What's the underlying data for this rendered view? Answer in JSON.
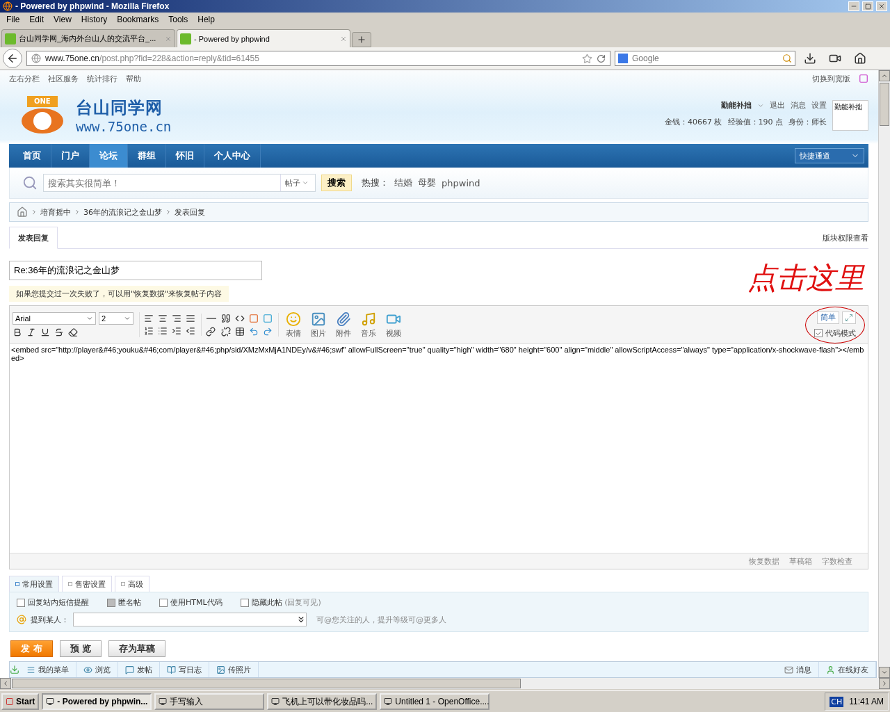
{
  "window": {
    "title": "- Powered by phpwind - Mozilla Firefox"
  },
  "menu": [
    "File",
    "Edit",
    "View",
    "History",
    "Bookmarks",
    "Tools",
    "Help"
  ],
  "browser_tabs": [
    {
      "label": "台山同学网_海内外台山人的交流平台_...",
      "selected": false
    },
    {
      "label": "- Powered by phpwind",
      "selected": true
    }
  ],
  "address": {
    "host": "www.75one.cn",
    "path": "/post.php?fid=228&action=reply&tid=61455"
  },
  "web_search": {
    "placeholder": "Google"
  },
  "page": {
    "top_links": [
      "左右分栏",
      "社区服务",
      "统计排行",
      "帮助"
    ],
    "switch_link": "切换到宽版",
    "logo": {
      "badge": "ONE",
      "name": "台山同学网",
      "url": "www.75one.cn"
    },
    "user": {
      "name": "勤能补拙",
      "links": [
        "退出",
        "消息",
        "设置"
      ],
      "stats": [
        "金钱：40667 枚",
        "经验值：190 点",
        "身份：师长"
      ],
      "avatar_label": "勤能补拙"
    },
    "nav": [
      {
        "label": "首页",
        "selected": false
      },
      {
        "label": "门户",
        "selected": false
      },
      {
        "label": "论坛",
        "selected": true
      },
      {
        "label": "群组",
        "selected": false
      },
      {
        "label": "怀旧",
        "selected": false
      },
      {
        "label": "个人中心",
        "selected": false
      }
    ],
    "quick_access": "快捷通道",
    "search": {
      "placeholder": "搜索其实很简单！",
      "scope": "帖子",
      "button": "搜索",
      "hot_label": "热搜：",
      "hot": [
        "结婚",
        "母婴",
        "phpwind"
      ]
    },
    "breadcrumb": [
      "培育摇中",
      "36年的流浪记之金山梦",
      "发表回复"
    ],
    "post_tab": {
      "label": "发表回复",
      "selected": true
    },
    "permissions_link": "版块权限查看",
    "subject": "Re:36年的流浪记之金山梦",
    "hint": "如果您提交过一次失败了，可以用\"恢复数据\"来恢复帖子内容",
    "annotation": "点击这里",
    "editor": {
      "font": "Arial",
      "size": "2",
      "media": [
        "表情",
        "图片",
        "附件",
        "音乐",
        "视频"
      ],
      "simple_button": "简单",
      "code_mode": {
        "label": "代码模式",
        "checked": true
      },
      "content": "<embed src=\"http://player&#46;youku&#46;com/player&#46;php/sid/XMzMxMjA1NDEy/v&#46;swf\" allowFullScreen=\"true\" quality=\"high\" width=\"680\" height=\"600\" align=\"middle\" allowScriptAccess=\"always\" type=\"application/x-shockwave-flash\"></embed>",
      "footer_links": [
        "恢复数据",
        "草稿箱",
        "字数检查"
      ]
    },
    "settings_tabs": [
      {
        "label": "常用设置",
        "selected": true
      },
      {
        "label": "售密设置",
        "selected": false
      },
      {
        "label": "高级",
        "selected": false
      }
    ],
    "options": [
      {
        "label": "回复站内短信提醒",
        "checked": false,
        "disabled": false
      },
      {
        "label": "匿名帖",
        "checked": false,
        "disabled": true
      },
      {
        "label": "使用HTML代码",
        "checked": false,
        "disabled": false
      },
      {
        "label": "隐藏此帖",
        "note": "(回复可见)",
        "checked": false,
        "disabled": false
      }
    ],
    "mention": {
      "label": "提到某人：",
      "hint": "可@您关注的人，提升等级可@更多人"
    },
    "actions": [
      {
        "label": "发 布",
        "kind": "primary"
      },
      {
        "label": "预 览",
        "kind": "normal"
      },
      {
        "label": "存为草稿",
        "kind": "normal"
      }
    ],
    "bottom_bar": {
      "left": [
        "我的菜单",
        "浏览",
        "发帖",
        "写日志",
        "传照片"
      ],
      "right": [
        "消息",
        "在线好友"
      ]
    }
  },
  "taskbar": {
    "start": "Start",
    "tasks": [
      {
        "label": "- Powered by phpwin...",
        "selected": true
      },
      {
        "label": "手写输入",
        "selected": false
      },
      {
        "label": "飞机上可以带化妆品吗...",
        "selected": false
      },
      {
        "label": "Untitled 1 - OpenOffice....",
        "selected": false
      }
    ],
    "lang": "CH",
    "clock": "11:41 AM"
  }
}
